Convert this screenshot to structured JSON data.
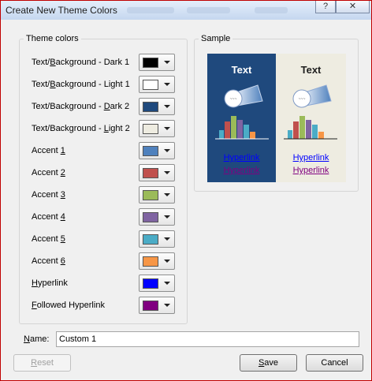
{
  "window": {
    "title": "Create New Theme Colors",
    "help_label": "?",
    "close_label": "✕"
  },
  "theme_colors": {
    "group_label": "Theme colors",
    "rows": [
      {
        "pre": "Text/",
        "key": "B",
        "post": "ackground - Dark 1",
        "color": "#000000"
      },
      {
        "pre": "Text/",
        "key": "B",
        "post": "ackground - Light 1",
        "color": "#ffffff"
      },
      {
        "pre": "Text/Background - ",
        "key": "D",
        "post": "ark 2",
        "color": "#1f497d"
      },
      {
        "pre": "Text/Background - ",
        "key": "L",
        "post": "ight 2",
        "color": "#eeece1"
      },
      {
        "pre": "Accent ",
        "key": "1",
        "post": "",
        "color": "#4f81bd"
      },
      {
        "pre": "Accent ",
        "key": "2",
        "post": "",
        "color": "#c0504d"
      },
      {
        "pre": "Accent ",
        "key": "3",
        "post": "",
        "color": "#9bbb59"
      },
      {
        "pre": "Accent ",
        "key": "4",
        "post": "",
        "color": "#8064a2"
      },
      {
        "pre": "Accent ",
        "key": "5",
        "post": "",
        "color": "#4bacc6"
      },
      {
        "pre": "Accent ",
        "key": "6",
        "post": "",
        "color": "#f79646"
      },
      {
        "pre": "",
        "key": "H",
        "post": "yperlink",
        "color": "#0000ff"
      },
      {
        "pre": "",
        "key": "F",
        "post": "ollowed Hyperlink",
        "color": "#800080"
      }
    ]
  },
  "sample": {
    "group_label": "Sample",
    "dark": {
      "text": "Text",
      "hyperlink": "Hyperlink",
      "followed": "Hyperlink",
      "text_color": "#ffffff",
      "link_color": "#0000ff",
      "followed_color": "#800080"
    },
    "light": {
      "text": "Text",
      "hyperlink": "Hyperlink",
      "followed": "Hyperlink",
      "text_color": "#1f1f1f",
      "link_color": "#0000ff",
      "followed_color": "#800080"
    }
  },
  "name": {
    "label_key": "N",
    "label_rest": "ame:",
    "value": "Custom 1"
  },
  "buttons": {
    "reset_key": "R",
    "reset_rest": "eset",
    "save_key": "S",
    "save_rest": "ave",
    "cancel": "Cancel"
  }
}
